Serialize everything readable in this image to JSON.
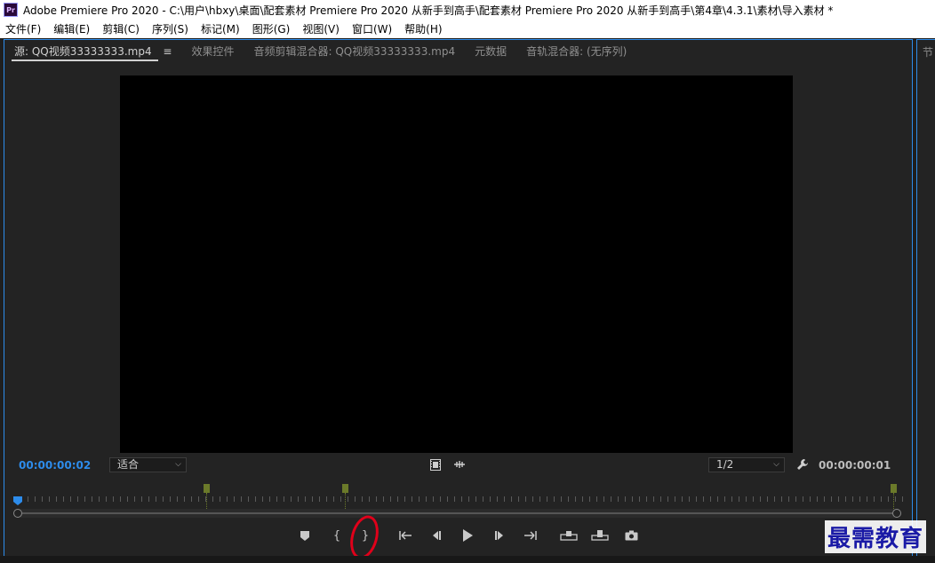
{
  "window": {
    "app_icon_text": "Pr",
    "title": "Adobe Premiere Pro 2020 - C:\\用户\\hbxy\\桌面\\配套素材 Premiere Pro 2020 从新手到高手\\配套素材 Premiere Pro 2020 从新手到高手\\第4章\\4.3.1\\素材\\导入素材 *"
  },
  "menu": [
    "文件(F)",
    "编辑(E)",
    "剪辑(C)",
    "序列(S)",
    "标记(M)",
    "图形(G)",
    "视图(V)",
    "窗口(W)",
    "帮助(H)"
  ],
  "tabs": [
    {
      "label": "源: QQ视频33333333.mp4",
      "active": true,
      "menu_glyph": "≡"
    },
    {
      "label": "效果控件",
      "active": false
    },
    {
      "label": "音频剪辑混合器: QQ视频33333333.mp4",
      "active": false
    },
    {
      "label": "元数据",
      "active": false
    },
    {
      "label": "音轨混合器: (无序列)",
      "active": false
    }
  ],
  "right_strip_label": "节",
  "source_monitor": {
    "current_timecode": "00:00:00:02",
    "duration_timecode": "00:00:00:01",
    "zoom_select": "适合",
    "resolution_select": "1/2"
  },
  "icons": {
    "film": "film-icon",
    "drag_audio": "drag-audio-icon",
    "wrench": "wrench-icon"
  },
  "transport": [
    {
      "name": "add-marker-button",
      "glyph": "⬟"
    },
    {
      "name": "mark-in-button",
      "glyph": "{"
    },
    {
      "name": "mark-out-button",
      "glyph": "}"
    },
    {
      "name": "go-to-in-button",
      "glyph": "{⇤"
    },
    {
      "name": "step-back-button",
      "glyph": "◀|"
    },
    {
      "name": "play-button",
      "glyph": "▶"
    },
    {
      "name": "step-forward-button",
      "glyph": "|▶"
    },
    {
      "name": "go-to-out-button",
      "glyph": "⇥}"
    },
    {
      "name": "insert-button",
      "glyph": "▭"
    },
    {
      "name": "overwrite-button",
      "glyph": "▬"
    },
    {
      "name": "export-frame-button",
      "glyph": "◉"
    }
  ],
  "watermark": "最需教育",
  "colors": {
    "accent": "#2d8ceb",
    "panel_bg": "#232323",
    "marker": "#6b7a2a",
    "annotation": "#e0001a"
  }
}
